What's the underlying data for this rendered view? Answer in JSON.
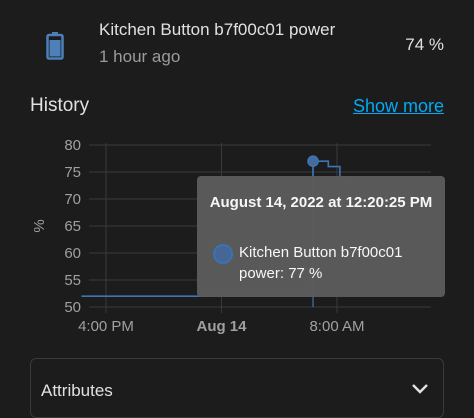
{
  "entity": {
    "name": "Kitchen Button b7f00c01 power",
    "last_changed": "1 hour ago",
    "state": "74 %",
    "icon": "battery-icon"
  },
  "history": {
    "title": "History",
    "show_more": "Show more"
  },
  "chart_data": {
    "type": "line",
    "ylabel": "%",
    "yticks": [
      "80",
      "75",
      "70",
      "65",
      "60",
      "55",
      "50"
    ],
    "ylim": [
      50,
      80
    ],
    "xticks": [
      "4:00 PM",
      "Aug 14",
      "8:00 AM"
    ],
    "series": [
      {
        "name": "Kitchen Button b7f00c01 power",
        "color": "#3b76b6",
        "points": [
          {
            "t": -1.7,
            "v": 52
          },
          {
            "t": 14.3,
            "v": 52
          },
          {
            "t": 14.34,
            "v": 77
          },
          {
            "t": 15.4,
            "v": 77
          },
          {
            "t": 15.4,
            "v": 76
          },
          {
            "t": 16.2,
            "v": 76
          },
          {
            "t": 16.2,
            "v": 74
          },
          {
            "t": 16.7,
            "v": 74
          }
        ]
      }
    ],
    "grid": true
  },
  "tooltip": {
    "title": "August 14, 2022 at 12:20:25 PM",
    "body": "Kitchen Button b7f00c01 power: 77 %"
  },
  "attributes": {
    "label": "Attributes"
  }
}
